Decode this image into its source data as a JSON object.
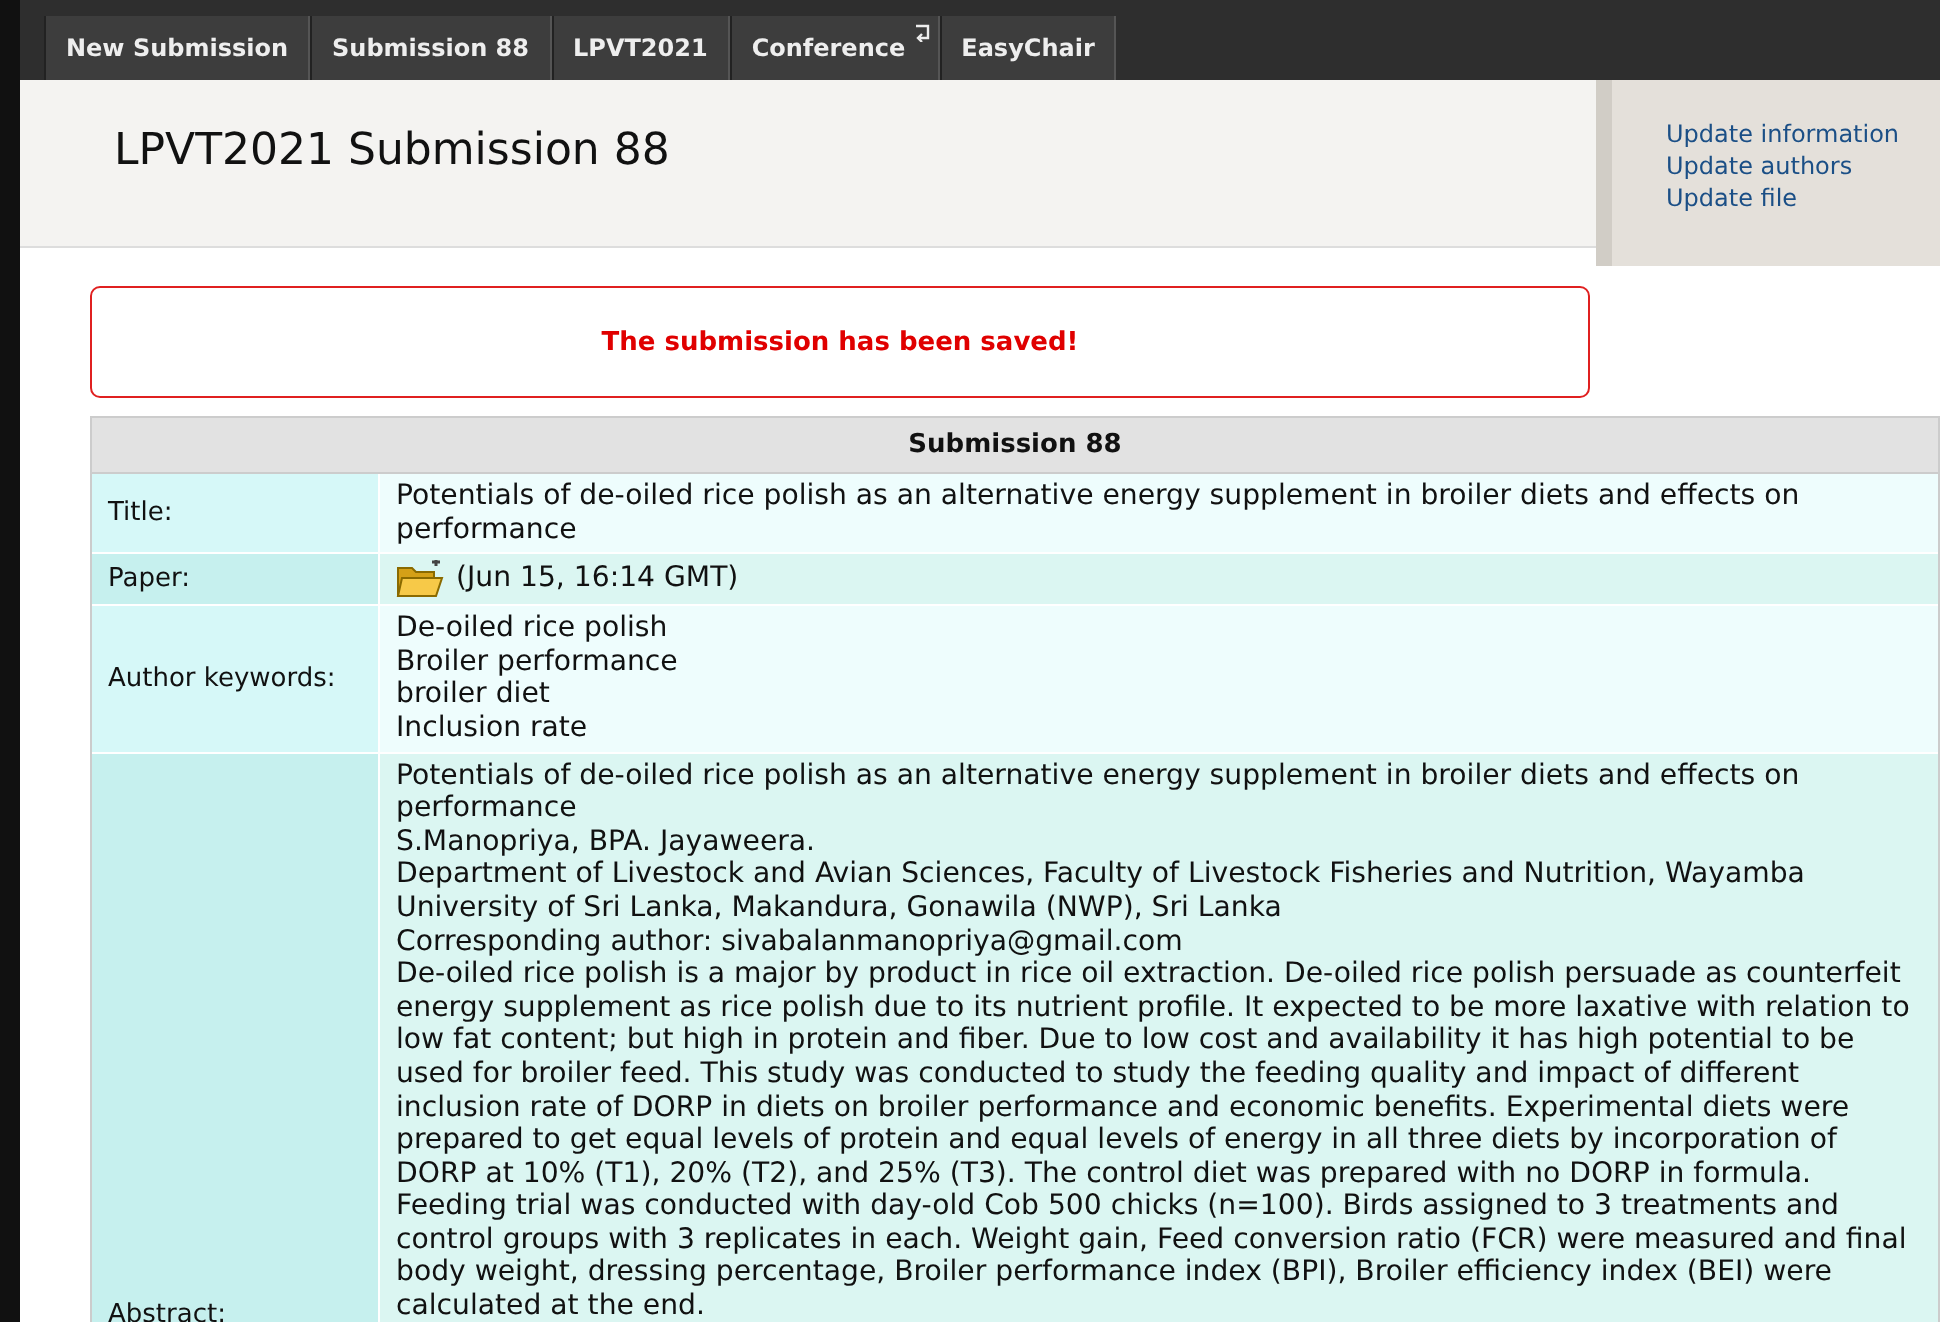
{
  "nav_tabs": [
    {
      "label": "New Submission",
      "has_return_icon": false
    },
    {
      "label": "Submission 88",
      "has_return_icon": false
    },
    {
      "label": "LPVT2021",
      "has_return_icon": false
    },
    {
      "label": "Conference",
      "has_return_icon": true
    },
    {
      "label": "EasyChair",
      "has_return_icon": false
    }
  ],
  "page_title": "LPVT2021 Submission 88",
  "side_links": [
    "Update information",
    "Update authors",
    "Update file"
  ],
  "message": "The submission has been saved!",
  "table": {
    "heading": "Submission 88",
    "rows": [
      {
        "kind": "text",
        "label": "Title:",
        "lines": [
          "Potentials of de-oiled rice polish as an alternative energy supplement in broiler diets and effects on",
          "performance"
        ]
      },
      {
        "kind": "file",
        "label": "Paper:",
        "lines": [
          "(Jun 15, 16:14 GMT)"
        ]
      },
      {
        "kind": "text",
        "label": "Author keywords:",
        "lines": [
          "De-oiled rice polish",
          "Broiler performance",
          "broiler diet",
          "Inclusion rate"
        ]
      },
      {
        "kind": "text",
        "label": "Abstract:",
        "lines": [
          "Potentials of de-oiled rice polish as an alternative energy supplement in broiler diets and effects on",
          "performance",
          "S.Manopriya, BPA. Jayaweera.",
          "Department of Livestock and Avian Sciences, Faculty of Livestock Fisheries and Nutrition, Wayamba",
          "University of Sri Lanka, Makandura, Gonawila (NWP), Sri Lanka",
          "Corresponding author: sivabalanmanopriya@gmail.com",
          "De-oiled rice polish is a major by product in rice oil extraction. De-oiled rice polish persuade as counterfeit",
          "energy supplement as rice polish due to its nutrient profile. It expected to be more laxative with relation to",
          "low fat content; but high in protein and fiber. Due to low cost and availability it has high potential to be",
          "used for broiler feed. This study was conducted to study the feeding quality and impact of different",
          "inclusion rate of DORP in diets on broiler performance and economic benefits. Experimental diets were",
          "prepared to get equal levels of protein and equal levels of energy in all three diets by incorporation of",
          "DORP at 10% (T1), 20% (T2), and 25% (T3). The control diet was prepared with no DORP in formula.",
          "Feeding trial was conducted with day-old Cob 500 chicks (n=100). Birds assigned to 3 treatments and",
          "control groups with 3 replicates in each. Weight gain, Feed conversion ratio (FCR) were measured and final",
          "body weight, dressing percentage, Broiler performance index (BPI), Broiler efficiency index (BEI) were",
          "calculated at the end."
        ]
      }
    ]
  }
}
